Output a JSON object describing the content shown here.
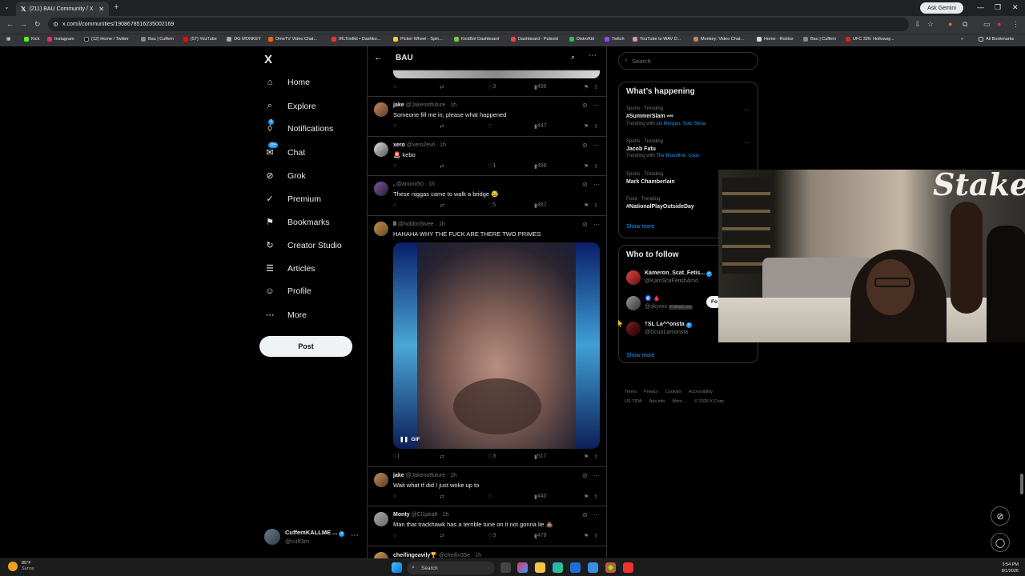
{
  "browser": {
    "tab_title": "(211) BAU Community / X",
    "url": "x.com/i/communities/1908678516235002169",
    "gemini_label": "Ask Gemini",
    "bookmarks": [
      "Kick",
      "Instagram",
      "(12) Home / Twitter",
      "Bau | Cuffem",
      "(57) YouTube",
      "OG MONKEY",
      "OmeTV Video Chat...",
      "IRLToolkit • Dashbo...",
      "Picker Wheel - Spin...",
      "KickBot Dashboard",
      "Dashboard - Pulsoid",
      "DistroKid",
      "Twitch",
      "YouTube to WAV D...",
      "Monkey: Video Chat...",
      "Home - Roblox",
      "Bau | Cuffem",
      "UFC 326: Holloway..."
    ],
    "all_bookmarks": "All Bookmarks"
  },
  "nav": {
    "logo": "X",
    "items": [
      {
        "label": "Home",
        "icon": "home-icon",
        "glyph": "⌂"
      },
      {
        "label": "Explore",
        "icon": "search-icon",
        "glyph": "⌕"
      },
      {
        "label": "Notifications",
        "icon": "bell-icon",
        "glyph": "🔔︎"
      },
      {
        "label": "Chat",
        "icon": "chat-icon",
        "glyph": "✉"
      },
      {
        "label": "Grok",
        "icon": "grok-icon",
        "glyph": "⊘"
      },
      {
        "label": "Premium",
        "icon": "premium-icon",
        "glyph": "✓"
      },
      {
        "label": "Bookmarks",
        "icon": "bookmark-icon",
        "glyph": "⚑"
      },
      {
        "label": "Creator Studio",
        "icon": "studio-icon",
        "glyph": "↻"
      },
      {
        "label": "Articles",
        "icon": "articles-icon",
        "glyph": "☰"
      },
      {
        "label": "Profile",
        "icon": "profile-icon",
        "glyph": "☺"
      },
      {
        "label": "More",
        "icon": "more-icon",
        "glyph": "⋯"
      }
    ],
    "notif_badge": "1",
    "chat_badge": "20+",
    "post_label": "Post",
    "account_name": "CuffemKALLME ...",
    "account_handle": "@cuff3m"
  },
  "feed": {
    "title": "BAU",
    "first_actions": {
      "likes": "3",
      "views": "496"
    },
    "tweets": [
      {
        "name": "jake",
        "handle": "@Jakenotfuture",
        "time": "1h",
        "text": "Someone fill me in, please what happened",
        "replies": "",
        "retweets": "",
        "likes": "",
        "views": "447"
      },
      {
        "name": "xero",
        "handle": "@xero2evil",
        "time": "1h",
        "text": "🚨 kebo",
        "replies": "",
        "retweets": "",
        "likes": "1",
        "views": "488"
      },
      {
        "name": ".",
        "handle": "@anonx50",
        "time": "1h",
        "text": "These niggas came to walk a bridge 😂",
        "replies": "",
        "retweets": "",
        "likes": "5",
        "views": "487"
      },
      {
        "name": "ll",
        "handle": "@holdon5ivee",
        "time": "1h",
        "text": "HAHAHA WHY THE FUCK ARE THERE TWO PRIMES",
        "replies": "1",
        "retweets": "",
        "likes": "3",
        "views": "517",
        "gif_label": "GIF"
      },
      {
        "name": "jake",
        "handle": "@Jakenotfuture",
        "time": "1h",
        "text": "Wait what tf did I just woke up to",
        "replies": "",
        "retweets": "",
        "likes": "",
        "views": "440"
      },
      {
        "name": "Monty",
        "handle": "@Cl1pkatt",
        "time": "1h",
        "text": "Man that trackhawk has a terrible tune on it not gonna lie 💩",
        "replies": "",
        "retweets": "",
        "likes": "3",
        "views": "478"
      },
      {
        "name": "cheifingeavily🏆",
        "handle": "@cheifin35e",
        "time": "1h",
        "text": ""
      }
    ]
  },
  "sidebar": {
    "search_placeholder": "Search",
    "happening_title": "What’s happening",
    "trends": [
      {
        "category": "Sports · Trending",
        "title": "#SummerSlam",
        "with_prefix": "Trending with",
        "with": "Liv Morgan, Solo Sikoa"
      },
      {
        "category": "Sports · Trending",
        "title": "Jacob Fatu",
        "with_prefix": "Trending with",
        "with": "The Bloodline, Usos"
      },
      {
        "category": "Sports · Trending",
        "title": "Mark Chamberlain",
        "with_prefix": "",
        "with": ""
      },
      {
        "category": "Food · Trending",
        "title": "#NationalPlayOutsideDay",
        "with_prefix": "",
        "with": ""
      }
    ],
    "show_more": "Show more",
    "follow_title": "Who to follow",
    "follows": [
      {
        "name": "Kameron_Scat_Fetis...",
        "handle": "@KamScaFetishAmo"
      },
      {
        "name": "🧿 🩸",
        "handle": "@skyxxx",
        "tag": "Follows you"
      },
      {
        "name": "†SL La^^onsta",
        "handle": "@DcuoLamonsta"
      }
    ],
    "follow_btn": "Fo",
    "show_more_2": "Show more",
    "footer": [
      "Terms",
      "Privacy",
      "Cookies",
      "Accessibility",
      "US TIDA",
      "Ads info",
      "More ...",
      "© 2026 X Corp."
    ]
  },
  "overlay": {
    "sign_text": "Stake"
  },
  "taskbar": {
    "temp": "85°F",
    "weather": "Sunny",
    "search": "Search",
    "time": "3:54 PM",
    "date": "8/1/2026"
  }
}
